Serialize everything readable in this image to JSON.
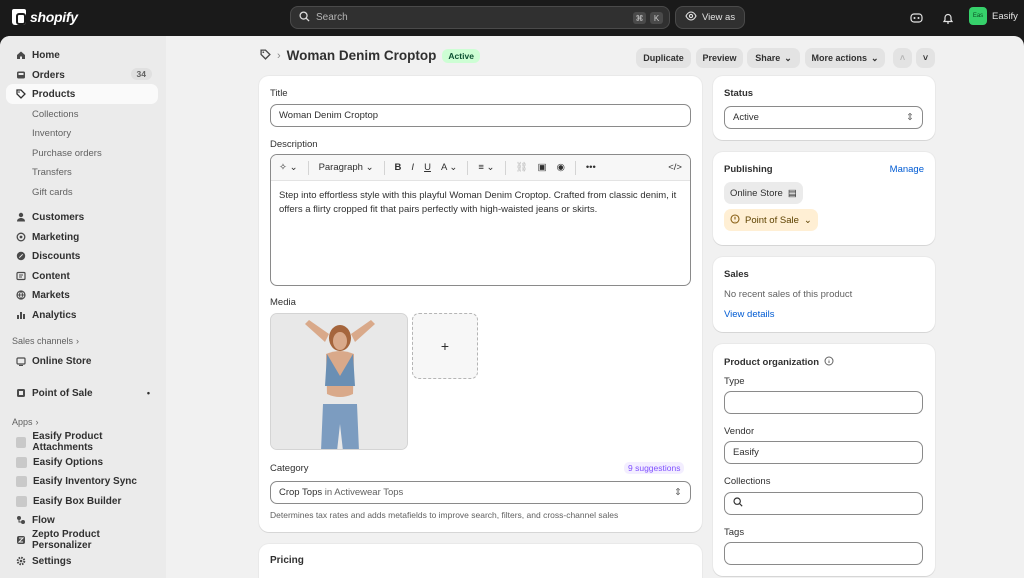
{
  "topbar": {
    "brand": "shopify",
    "search_placeholder": "Search",
    "shortcut_keys": [
      "⌘",
      "K"
    ],
    "view_as": "View as",
    "store_initials": "Eas",
    "store_name": "Easify"
  },
  "sidebar": {
    "items": [
      {
        "label": "Home",
        "icon": "home-icon"
      },
      {
        "label": "Orders",
        "icon": "inbox-icon",
        "count": "34"
      },
      {
        "label": "Products",
        "icon": "tag-icon",
        "active": true
      }
    ],
    "product_sub": [
      "Collections",
      "Inventory",
      "Purchase orders",
      "Transfers",
      "Gift cards"
    ],
    "items2": [
      {
        "label": "Customers",
        "icon": "person-icon"
      },
      {
        "label": "Marketing",
        "icon": "target-icon"
      },
      {
        "label": "Discounts",
        "icon": "discount-icon"
      },
      {
        "label": "Content",
        "icon": "content-icon"
      },
      {
        "label": "Markets",
        "icon": "globe-icon"
      },
      {
        "label": "Analytics",
        "icon": "chart-icon"
      }
    ],
    "sales_channels_heading": "Sales channels",
    "online_store": "Online Store",
    "point_of_sale": "Point of Sale",
    "apps_heading": "Apps",
    "apps": [
      "Easify Product Attachments",
      "Easify Options",
      "Easify Inventory Sync",
      "Easify Box Builder",
      "Flow",
      "Zepto Product Personalizer"
    ],
    "settings": "Settings"
  },
  "header": {
    "title": "Woman Denim Croptop",
    "status_badge": "Active",
    "buttons": {
      "duplicate": "Duplicate",
      "preview": "Preview",
      "share": "Share",
      "more_actions": "More actions"
    }
  },
  "product": {
    "title_label": "Title",
    "title_value": "Woman Denim Croptop",
    "description_label": "Description",
    "editor_paragraph": "Paragraph",
    "description_text": "Step into effortless style with this playful Woman Denim Croptop. Crafted from classic denim, it offers a flirty cropped fit that pairs perfectly with high-waisted jeans or skirts.",
    "media_label": "Media",
    "category_label": "Category",
    "suggestions": "9 suggestions",
    "category_value": "Crop Tops",
    "category_in": "in Activewear Tops",
    "category_hint": "Determines tax rates and adds metafields to improve search, filters, and cross-channel sales",
    "pricing_heading": "Pricing"
  },
  "right": {
    "status_label": "Status",
    "status_value": "Active",
    "publishing_label": "Publishing",
    "manage": "Manage",
    "channel_online": "Online Store",
    "channel_pos": "Point of Sale",
    "sales_label": "Sales",
    "sales_text": "No recent sales of this product",
    "view_details": "View details",
    "org_label": "Product organization",
    "type_label": "Type",
    "vendor_label": "Vendor",
    "vendor_value": "Easify",
    "collections_label": "Collections",
    "tags_label": "Tags"
  },
  "colors": {
    "topbar": "#1a1a1a",
    "active_badge": "#cdfed4",
    "link": "#005bd3",
    "pos_chip": "#ffefd4",
    "suggestion": "#8051ff"
  }
}
